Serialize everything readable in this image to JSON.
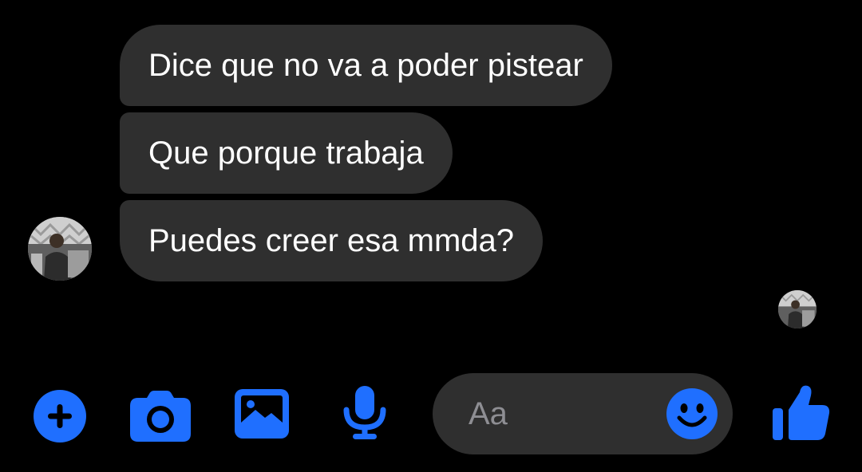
{
  "messages": [
    {
      "text": "Dice que no va a poder pistear"
    },
    {
      "text": "Que porque trabaja"
    },
    {
      "text": "Puedes creer esa mmda?"
    }
  ],
  "composer": {
    "placeholder": "Aa",
    "tools": [
      "plus-icon",
      "camera-icon",
      "gallery-icon",
      "microphone-icon"
    ],
    "emoji_icon": "smiley-icon",
    "send_icon": "thumbs-up-icon"
  },
  "colors": {
    "background": "#000000",
    "bubble": "#2f2f2f",
    "accent": "#1f6fff",
    "text": "#ffffff",
    "placeholder": "#8e8e93"
  }
}
